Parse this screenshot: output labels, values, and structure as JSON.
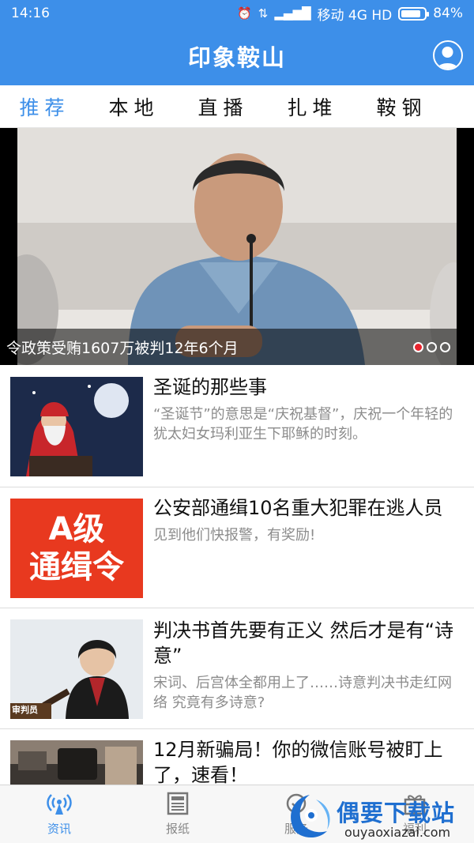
{
  "status_bar": {
    "time": "14:16",
    "carrier": "移动 4G HD",
    "battery": "84%"
  },
  "header": {
    "title": "印象鞍山",
    "accent_color": "#3d8fe9"
  },
  "tabs": [
    {
      "label": "推荐",
      "active": true
    },
    {
      "label": "本地",
      "active": false
    },
    {
      "label": "直播",
      "active": false
    },
    {
      "label": "扎堆",
      "active": false
    },
    {
      "label": "鞍钢",
      "active": false
    }
  ],
  "banner": {
    "caption": "令政策受贿1607万被判12年6个月",
    "slide_count": 3,
    "active_slide": 1
  },
  "news": [
    {
      "title": "圣诞的那些事",
      "summary": "“圣诞节”的意思是“庆祝基督”，庆祝一个年轻的犹太妇女玛利亚生下耶稣的时刻。"
    },
    {
      "title": "公安部通缉10名重大犯罪在逃人员",
      "summary": "见到他们快报警，有奖励!",
      "thumb_text_line1": "A级",
      "thumb_text_line2": "通缉令"
    },
    {
      "title": "判决书首先要有正义  然后才是有“诗意”",
      "summary": "宋词、后宫体全都用上了……诗意判决书走红网络 究竟有多诗意?",
      "thumb_text": "审判员"
    },
    {
      "title": "12月新骗局！你的微信账号被盯上了，速看！",
      "summary": ""
    }
  ],
  "bottom_nav": [
    {
      "label": "资讯",
      "icon": "broadcast-icon",
      "active": true
    },
    {
      "label": "报纸",
      "icon": "newspaper-icon",
      "active": false
    },
    {
      "label": "服务",
      "icon": "service-icon",
      "active": false
    },
    {
      "label": "福利",
      "icon": "gift-icon",
      "active": false
    }
  ],
  "watermark": {
    "title": "偶要下载站",
    "url": "ouyaoxiazai.com"
  }
}
